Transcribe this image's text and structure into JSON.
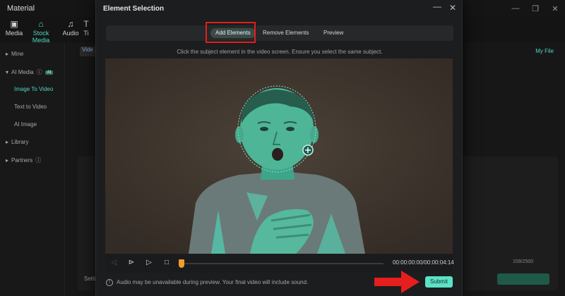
{
  "app": {
    "title": "Material",
    "window_controls": [
      "—",
      "❐",
      "✕"
    ]
  },
  "toolbar": {
    "items": [
      {
        "label": "Media",
        "icon": "media-icon"
      },
      {
        "label": "Stock Media",
        "icon": "store-icon"
      },
      {
        "label": "Audio",
        "icon": "music-icon"
      },
      {
        "label": "Ti",
        "icon": "text-icon"
      }
    ]
  },
  "sidebar": {
    "items": [
      {
        "label": "Mine"
      },
      {
        "label": "AI Media",
        "badge": "AI"
      },
      {
        "label": "Image To Video"
      },
      {
        "label": "Text to Video"
      },
      {
        "label": "AI Image"
      },
      {
        "label": "Library"
      },
      {
        "label": "Partners"
      }
    ]
  },
  "background": {
    "tab": "Vide",
    "my_file": "My File",
    "counter": "159/2500",
    "settings": "Setti"
  },
  "dialog": {
    "title": "Element Selection",
    "tabs": [
      "Add Elements",
      "Remove Elements",
      "Preview"
    ],
    "active_tab": "Add Elements",
    "hint": "Click the subject element in the video screen. Ensure you select the same subject.",
    "timecode": "00:00:00:00/00:00:04:14",
    "progress": 0,
    "notice": "Audio may be unavailable during preview. Your final video will include sound.",
    "submit_label": "Submit"
  },
  "colors": {
    "accent": "#4fd8c0",
    "submit": "#5ce2c6",
    "highlight": "#e02020",
    "arrow": "#e61e1e",
    "playhead": "#f19b2c"
  }
}
